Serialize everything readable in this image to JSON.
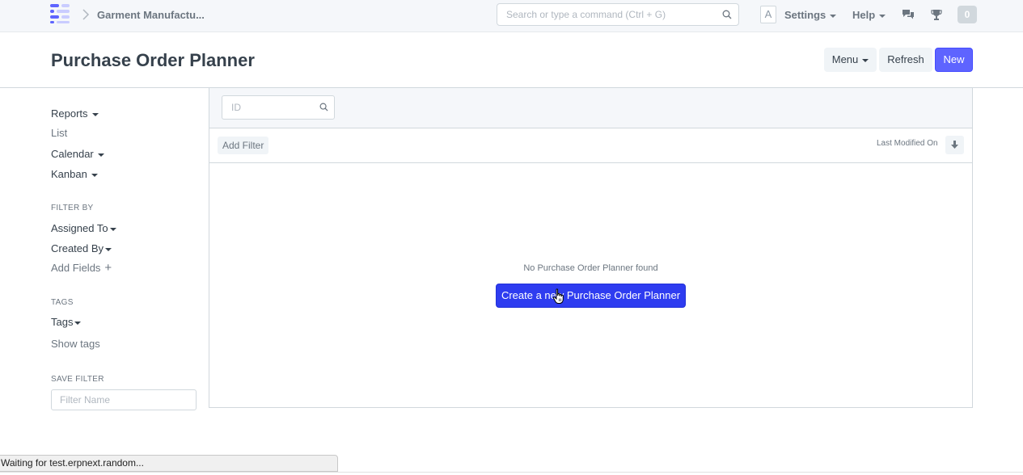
{
  "navbar": {
    "breadcrumb": "Garment Manufactu...",
    "search_placeholder": "Search or type a command (Ctrl + G)",
    "avatar_letter": "A",
    "settings_label": "Settings",
    "help_label": "Help",
    "notification_count": "0",
    "icons": [
      "app-logo-icon",
      "chevron-right-icon",
      "search-icon",
      "chat-icon",
      "trophy-icon"
    ]
  },
  "page": {
    "title": "Purchase Order Planner",
    "buttons": {
      "menu": "Menu",
      "refresh": "Refresh",
      "new": "New"
    }
  },
  "sidebar": {
    "views": [
      {
        "label": "Reports",
        "dropdown": true
      },
      {
        "label": "List",
        "dropdown": false
      },
      {
        "label": "Calendar",
        "dropdown": true
      },
      {
        "label": "Kanban",
        "dropdown": true
      }
    ],
    "filter_by_heading": "FILTER BY",
    "assigned_to": "Assigned To",
    "created_by": "Created By",
    "add_fields": "Add Fields",
    "tags_heading": "TAGS",
    "tags": "Tags",
    "show_tags": "Show tags",
    "save_filter_heading": "SAVE FILTER",
    "filter_name_placeholder": "Filter Name"
  },
  "list": {
    "id_placeholder": "ID",
    "add_filter": "Add Filter",
    "sort_label": "Last Modified On",
    "empty_message": "No Purchase Order Planner found",
    "create_button": "Create a new Purchase Order Planner"
  },
  "status_bar": {
    "text": "Waiting for test.erpnext.random..."
  },
  "colors": {
    "primary": "#5e64ff",
    "create_button": "#2e3cf0",
    "navbar_bg": "#f5f7fa",
    "text": "#36414c",
    "muted": "#6c7680"
  }
}
